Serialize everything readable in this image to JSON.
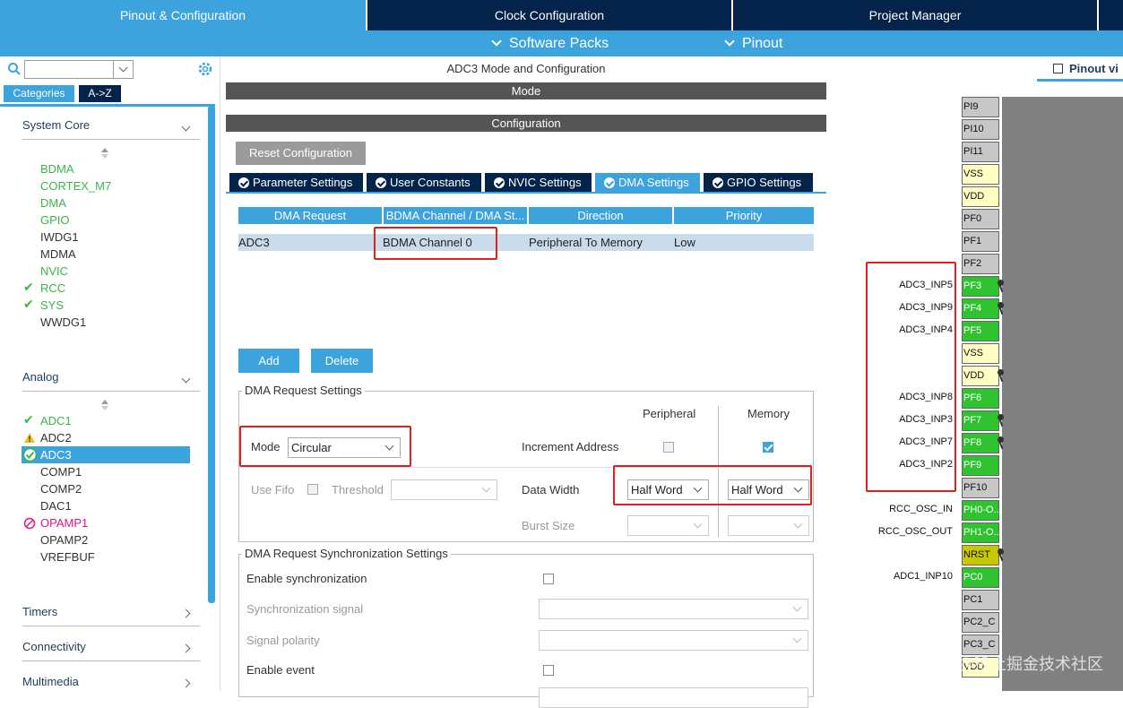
{
  "top_tabs": [
    "Pinout & Configuration",
    "Clock Configuration",
    "Project Manager"
  ],
  "sub_menu": [
    "Software Packs",
    "Pinout"
  ],
  "left": {
    "categories_btn": "Categories",
    "az_btn": "A->Z",
    "system_core": {
      "title": "System Core",
      "items": [
        "BDMA",
        "CORTEX_M7",
        "DMA",
        "GPIO",
        "IWDG1",
        "MDMA",
        "NVIC",
        "RCC",
        "SYS",
        "WWDG1"
      ]
    },
    "analog": {
      "title": "Analog",
      "items": [
        "ADC1",
        "ADC2",
        "ADC3",
        "COMP1",
        "COMP2",
        "DAC1",
        "OPAMP1",
        "OPAMP2",
        "VREFBUF"
      ]
    },
    "groups": [
      "Timers",
      "Connectivity",
      "Multimedia"
    ]
  },
  "mid": {
    "title": "ADC3 Mode and Configuration",
    "mode_bar": "Mode",
    "config_bar": "Configuration",
    "reset_btn": "Reset Configuration",
    "tabs": [
      "Parameter Settings",
      "User Constants",
      "NVIC Settings",
      "DMA Settings",
      "GPIO Settings"
    ],
    "table": {
      "headers": [
        "DMA Request",
        "BDMA Channel / DMA St...",
        "Direction",
        "Priority"
      ],
      "row": [
        "ADC3",
        "BDMA Channel 0",
        "Peripheral To Memory",
        "Low"
      ]
    },
    "add_btn": "Add",
    "delete_btn": "Delete",
    "req_settings": {
      "legend": "DMA Request Settings",
      "peripheral_col": "Peripheral",
      "memory_col": "Memory",
      "mode_label": "Mode",
      "mode_value": "Circular",
      "increment_label": "Increment Address",
      "use_fifo": "Use Fifo",
      "threshold": "Threshold",
      "data_width": "Data Width",
      "periph_width": "Half Word",
      "mem_width": "Half Word",
      "burst_size": "Burst Size"
    },
    "sync_settings": {
      "legend": "DMA Request Synchronization Settings",
      "enable_sync": "Enable synchronization",
      "sync_signal": "Synchronization signal",
      "signal_polarity": "Signal polarity",
      "enable_event": "Enable event"
    }
  },
  "right": {
    "pinout_view": "Pinout vi",
    "pins": [
      {
        "name": "PI9",
        "color": "gray",
        "label": ""
      },
      {
        "name": "PI10",
        "color": "gray",
        "label": ""
      },
      {
        "name": "PI11",
        "color": "gray",
        "label": ""
      },
      {
        "name": "VSS",
        "color": "yellow",
        "label": ""
      },
      {
        "name": "VDD",
        "color": "yellow",
        "label": ""
      },
      {
        "name": "PF0",
        "color": "gray",
        "label": ""
      },
      {
        "name": "PF1",
        "color": "gray",
        "label": ""
      },
      {
        "name": "PF2",
        "color": "gray",
        "label": ""
      },
      {
        "name": "PF3",
        "color": "green",
        "label": "ADC3_INP5"
      },
      {
        "name": "PF4",
        "color": "green",
        "label": "ADC3_INP9"
      },
      {
        "name": "PF5",
        "color": "green",
        "label": "ADC3_INP4"
      },
      {
        "name": "VSS",
        "color": "yellow",
        "label": ""
      },
      {
        "name": "VDD",
        "color": "yellow",
        "label": ""
      },
      {
        "name": "PF6",
        "color": "green",
        "label": "ADC3_INP8"
      },
      {
        "name": "PF7",
        "color": "green",
        "label": "ADC3_INP3"
      },
      {
        "name": "PF8",
        "color": "green",
        "label": "ADC3_INP7"
      },
      {
        "name": "PF9",
        "color": "green",
        "label": "ADC3_INP2"
      },
      {
        "name": "PF10",
        "color": "gray",
        "label": ""
      },
      {
        "name": "PH0-O...",
        "color": "green",
        "label": "RCC_OSC_IN"
      },
      {
        "name": "PH1-O...",
        "color": "green",
        "label": "RCC_OSC_OUT"
      },
      {
        "name": "NRST",
        "color": "olive",
        "label": ""
      },
      {
        "name": "PC0",
        "color": "green",
        "label": "ADC1_INP10"
      },
      {
        "name": "PC1",
        "color": "gray",
        "label": ""
      },
      {
        "name": "PC2_C",
        "color": "gray",
        "label": ""
      },
      {
        "name": "PC3_C",
        "color": "gray",
        "label": ""
      },
      {
        "name": "VDD",
        "color": "yellow",
        "label": ""
      }
    ],
    "watermark": "@稀土掘金技术社区"
  },
  "colors": {
    "navy": "#03234b",
    "accent": "#3ca3dc",
    "ok_green": "#39b54a",
    "highlight_red": "#e0201e"
  }
}
